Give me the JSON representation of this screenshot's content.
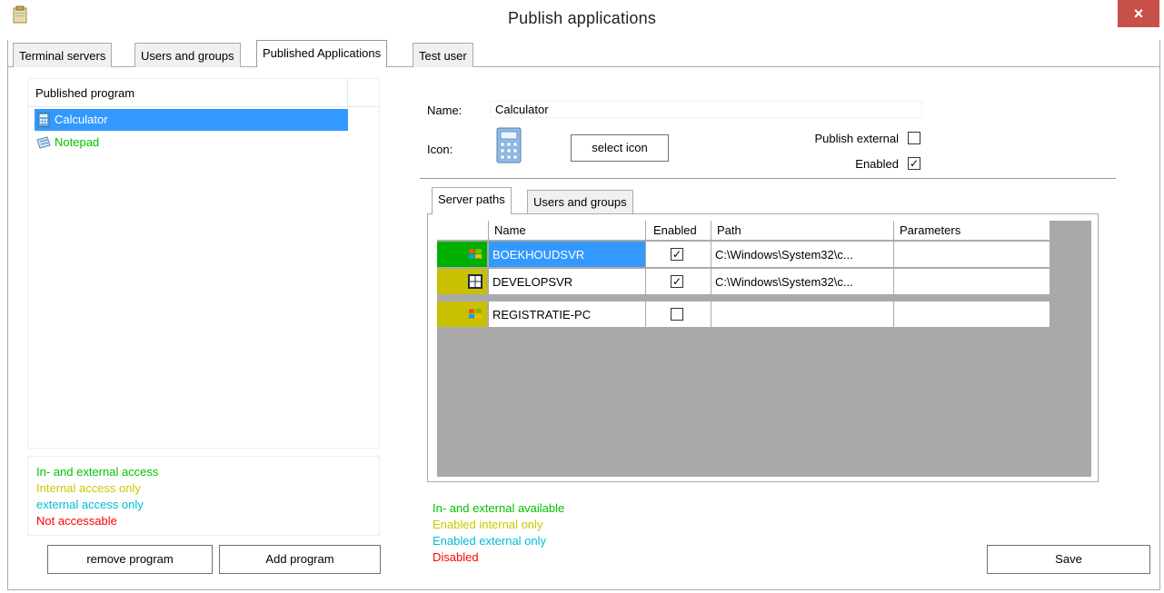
{
  "window": {
    "title": "Publish applications",
    "close_glyph": "×"
  },
  "tabs": [
    {
      "label": "Terminal servers"
    },
    {
      "label": "Users and groups"
    },
    {
      "label": "Published Applications"
    },
    {
      "label": "Test user"
    }
  ],
  "left_panel": {
    "list_header": "Published program",
    "programs": [
      {
        "label": "Calculator",
        "icon": "calculator-icon",
        "selected": true
      },
      {
        "label": "Notepad",
        "icon": "notepad-icon",
        "color": "#00c000"
      }
    ],
    "legend": [
      {
        "text": "In- and external access",
        "color": "#00c000"
      },
      {
        "text": "Internal access only",
        "color": "#c8c800"
      },
      {
        "text": "external access only",
        "color": "#00bcd4"
      },
      {
        "text": "Not accessable",
        "color": "#ff0000"
      }
    ],
    "remove_button": "remove program",
    "add_button": "Add program"
  },
  "details": {
    "name_label": "Name:",
    "name_value": "Calculator",
    "icon_label": "Icon:",
    "select_icon_button": "select icon",
    "publish_external_label": "Publish external",
    "publish_external_checked": false,
    "enabled_label": "Enabled",
    "enabled_checked": true
  },
  "subtabs": [
    {
      "label": "Server paths"
    },
    {
      "label": "Users and groups"
    }
  ],
  "servers_table": {
    "columns": [
      "Name",
      "Enabled",
      "Path",
      "Parameters"
    ],
    "rows": [
      {
        "status_color": "#00b000",
        "os_icon": "windows7-icon",
        "name": "BOEKHOUDSVR",
        "enabled": true,
        "path": "C:\\Windows\\System32\\c...",
        "parameters": "",
        "selected": true
      },
      {
        "status_color": "#c8c000",
        "os_icon": "windows8-icon",
        "name": "DEVELOPSVR",
        "enabled": true,
        "path": "C:\\Windows\\System32\\c...",
        "parameters": ""
      },
      {
        "status_color": "#c8c000",
        "os_icon": "windows7-icon",
        "name": "REGISTRATIE-PC",
        "enabled": false,
        "path": "",
        "parameters": ""
      }
    ]
  },
  "right_legend": [
    {
      "text": "In- and external available",
      "color": "#00c000"
    },
    {
      "text": "Enabled internal only",
      "color": "#c8c800"
    },
    {
      "text": "Enabled external only",
      "color": "#00bcd4"
    },
    {
      "text": "Disabled",
      "color": "#ff0000"
    }
  ],
  "save_button": "Save",
  "check_glyph": "✓"
}
